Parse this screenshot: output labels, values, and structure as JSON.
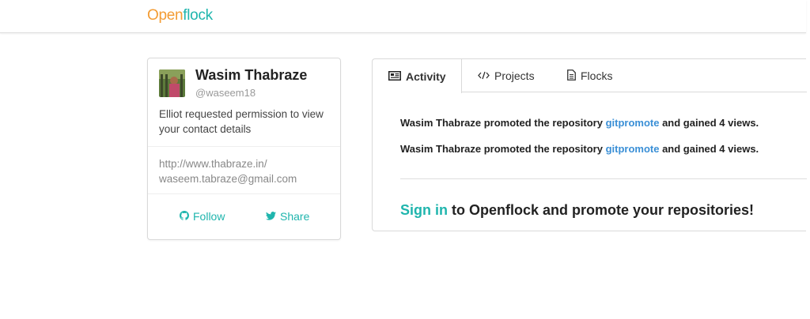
{
  "brand": {
    "part1": "Open",
    "part2": "flock"
  },
  "profile": {
    "name": "Wasim Thabraze",
    "handle": "@waseem18",
    "status": "Elliot requested permission to view your contact details",
    "website": "http://www.thabraze.in/",
    "email": "waseem.tabraze@gmail.com",
    "follow_label": "Follow",
    "share_label": "Share"
  },
  "tabs": [
    {
      "label": "Activity",
      "icon": "newspaper-icon"
    },
    {
      "label": "Projects",
      "icon": "code-icon"
    },
    {
      "label": "Flocks",
      "icon": "document-icon"
    }
  ],
  "activity": [
    {
      "prefix": "Wasim Thabraze promoted the repository ",
      "repo": "gitpromote",
      "suffix": " and gained 4 views."
    },
    {
      "prefix": "Wasim Thabraze promoted the repository ",
      "repo": "gitpromote",
      "suffix": " and gained 4 views."
    }
  ],
  "signin": {
    "link": "Sign in",
    "text": " to Openflock and promote your repositories!"
  },
  "colors": {
    "teal": "#1fb5ad",
    "orange": "#f39c34",
    "link_blue": "#3a8fd6"
  }
}
